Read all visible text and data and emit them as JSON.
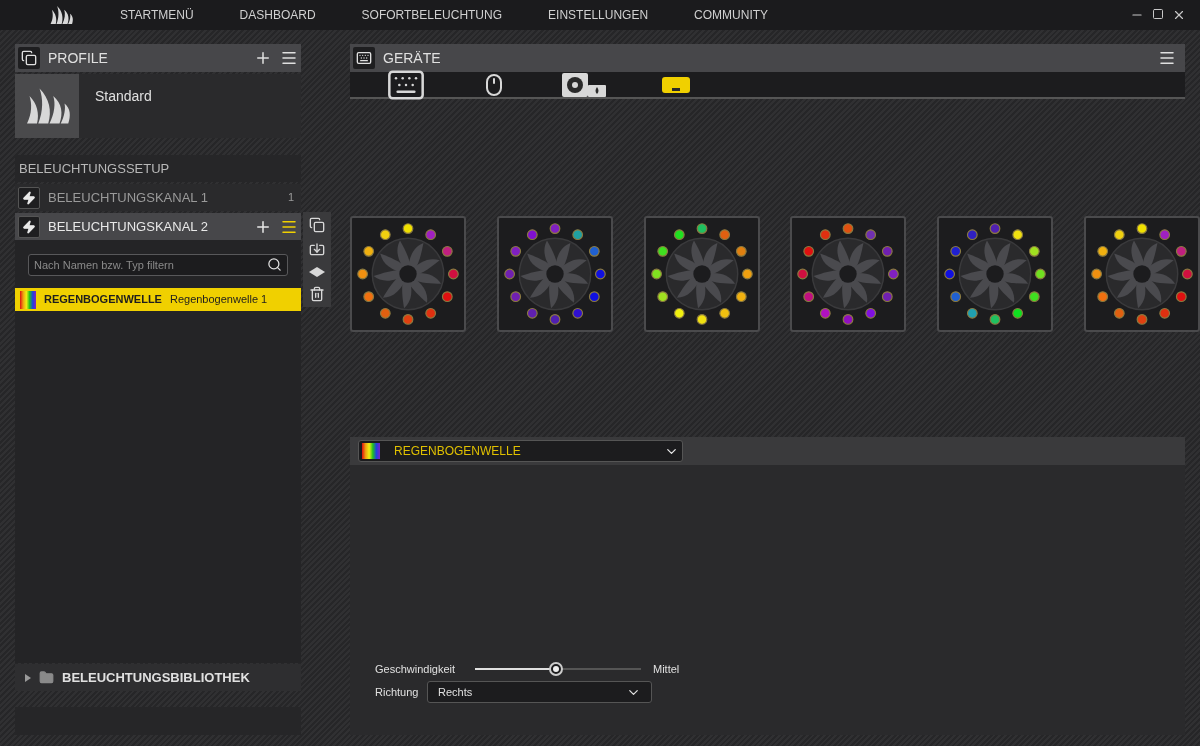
{
  "nav": [
    {
      "label": "STARTMENÜ",
      "selected": false
    },
    {
      "label": "DASHBOARD",
      "selected": false
    },
    {
      "label": "SOFORTBELEUCHTUNG",
      "selected": false
    },
    {
      "label": "EINSTELLUNGEN",
      "selected": false
    },
    {
      "label": "COMMUNITY",
      "selected": false
    }
  ],
  "profiles": {
    "title": "PROFILE",
    "items": [
      {
        "name": "Standard",
        "selected": true
      }
    ]
  },
  "setup": {
    "title": "BELEUCHTUNGSSETUP",
    "channels": [
      {
        "name": "BELEUCHTUNGSKANAL 1",
        "count": "1",
        "selected": false
      },
      {
        "name": "BELEUCHTUNGSKANAL 2",
        "selected": true
      }
    ],
    "search": {
      "placeholder": "Nach Namen bzw. Typ filtern"
    },
    "effects": [
      {
        "type": "REGENBOGENWELLE",
        "name": "Regenbogenwelle 1",
        "selected": true
      }
    ]
  },
  "library": {
    "title": "BELEUCHTUNGSBIBLIOTHEK",
    "expanded": false
  },
  "devices": {
    "title": "GERÄTE",
    "items": [
      {
        "kind": "keyboard",
        "selected": false
      },
      {
        "kind": "mouse",
        "selected": false
      },
      {
        "kind": "cooler",
        "selected": false
      },
      {
        "kind": "node",
        "selected": true
      }
    ]
  },
  "fans": [
    {
      "leds": [
        {
          "color": "#f0e000"
        },
        {
          "color": "#a020c0"
        },
        {
          "color": "#c02080"
        },
        {
          "color": "#d01040"
        },
        {
          "color": "#e01010"
        },
        {
          "color": "#e03010"
        },
        {
          "color": "#e04010"
        },
        {
          "color": "#e06010"
        },
        {
          "color": "#f07010"
        },
        {
          "color": "#f09010"
        },
        {
          "color": "#f0b010"
        },
        {
          "color": "#f0d010"
        }
      ]
    },
    {
      "leds": [
        {
          "color": "#8020c0"
        },
        {
          "color": "#20a0a0"
        },
        {
          "color": "#2060d0"
        },
        {
          "color": "#1010e0"
        },
        {
          "color": "#1010e0"
        },
        {
          "color": "#3010d0"
        },
        {
          "color": "#5020b0"
        },
        {
          "color": "#6020b0"
        },
        {
          "color": "#7020b0"
        },
        {
          "color": "#7020b0"
        },
        {
          "color": "#8020c0"
        },
        {
          "color": "#8010d0"
        }
      ]
    },
    {
      "leds": [
        {
          "color": "#20c060"
        },
        {
          "color": "#e06010"
        },
        {
          "color": "#e08010"
        },
        {
          "color": "#f0a010"
        },
        {
          "color": "#f0b010"
        },
        {
          "color": "#f0c010"
        },
        {
          "color": "#f0e010"
        },
        {
          "color": "#f0f010"
        },
        {
          "color": "#a0e020"
        },
        {
          "color": "#80e020"
        },
        {
          "color": "#40e020"
        },
        {
          "color": "#20e020"
        }
      ]
    },
    {
      "leds": [
        {
          "color": "#e05010"
        },
        {
          "color": "#7030b0"
        },
        {
          "color": "#7020b0"
        },
        {
          "color": "#8020c0"
        },
        {
          "color": "#7020b0"
        },
        {
          "color": "#8010e0"
        },
        {
          "color": "#9010c0"
        },
        {
          "color": "#b010c0"
        },
        {
          "color": "#c01080"
        },
        {
          "color": "#d01040"
        },
        {
          "color": "#e01010"
        },
        {
          "color": "#e03010"
        }
      ]
    },
    {
      "leds": [
        {
          "color": "#5020b0"
        },
        {
          "color": "#f0e010"
        },
        {
          "color": "#a0e020"
        },
        {
          "color": "#70e020"
        },
        {
          "color": "#40e020"
        },
        {
          "color": "#10e020"
        },
        {
          "color": "#20c060"
        },
        {
          "color": "#20a0b0"
        },
        {
          "color": "#2060d0"
        },
        {
          "color": "#1010e0"
        },
        {
          "color": "#2020d0"
        },
        {
          "color": "#3020c0"
        }
      ]
    },
    {
      "leds": [
        {
          "color": "#f0e000"
        },
        {
          "color": "#a020c0"
        },
        {
          "color": "#c02080"
        },
        {
          "color": "#d01040"
        },
        {
          "color": "#e01010"
        },
        {
          "color": "#e03010"
        },
        {
          "color": "#e04010"
        },
        {
          "color": "#e06010"
        },
        {
          "color": "#f07010"
        },
        {
          "color": "#f09010"
        },
        {
          "color": "#f0b010"
        },
        {
          "color": "#f0d010"
        }
      ]
    }
  ],
  "effect": {
    "value": "REGENBOGENWELLE",
    "speed": {
      "label": "Geschwindigkeit",
      "level": 0.49,
      "reading": "Mittel"
    },
    "direction": {
      "label": "Richtung",
      "value": "Rechts"
    }
  }
}
